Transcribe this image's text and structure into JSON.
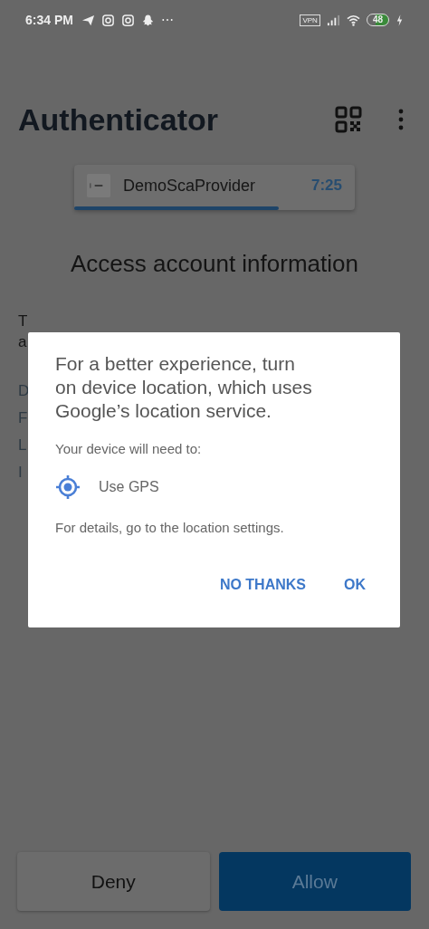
{
  "status_bar": {
    "time": "6:34 PM",
    "more": "⋯",
    "vpn": "VPN",
    "battery": "48"
  },
  "app_bar": {
    "title": "Authenticator"
  },
  "account_card": {
    "name": "DemoScaProvider",
    "timer": "7:25",
    "level": 0.73
  },
  "heading": "Access account information",
  "covered_texts": [
    "T",
    "a"
  ],
  "covered_rows": [
    "D",
    "F",
    "L",
    "I"
  ],
  "dialog": {
    "title": "For a better experience, turn on device location, which uses Google’s location service.",
    "subtitle": "Your device will need to:",
    "items": [
      {
        "text": "Use GPS"
      }
    ],
    "footer": "For details, go to the location settings.",
    "buttons": [
      {
        "label": "NO THANKS"
      },
      {
        "label": "OK"
      }
    ]
  },
  "actions": [
    {
      "label": "Deny",
      "kind": "secondary"
    },
    {
      "label": "Allow",
      "kind": "primary"
    }
  ]
}
